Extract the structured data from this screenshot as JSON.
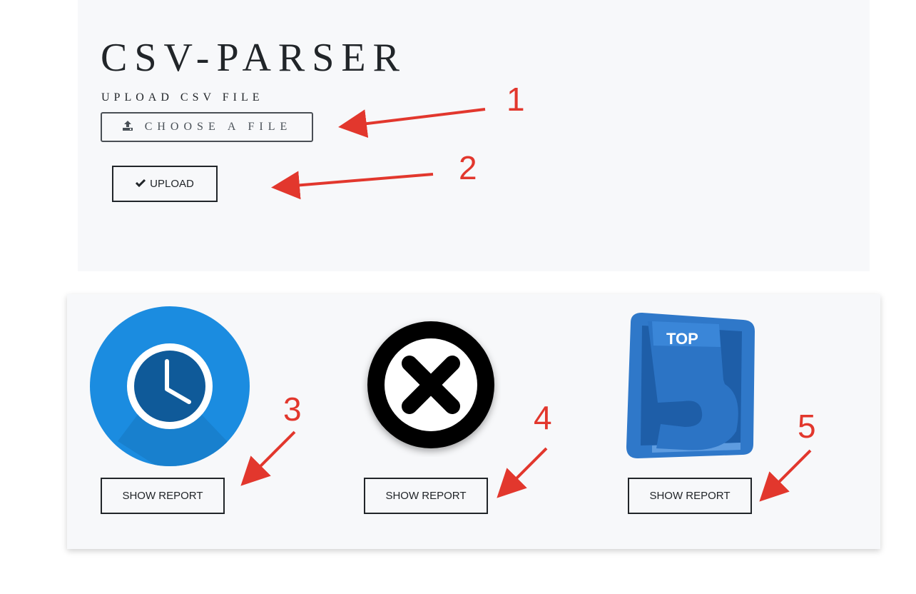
{
  "header": {
    "title": "CSV-PARSER",
    "upload_label": "UPLOAD CSV FILE",
    "choose_button_label": "CHOOSE A FILE",
    "choose_button_icon": "upload-icon",
    "upload_button_label": "UPLOAD",
    "upload_button_icon": "checkmark-icon"
  },
  "reports": [
    {
      "icon": "clock-icon",
      "button_label": "SHOW REPORT"
    },
    {
      "icon": "x-circle-icon",
      "button_label": "SHOW REPORT"
    },
    {
      "icon": "top-5-icon",
      "icon_text_top": "TOP",
      "icon_text_number": "5",
      "button_label": "SHOW REPORT"
    }
  ],
  "annotations": [
    "1",
    "2",
    "3",
    "4",
    "5"
  ],
  "colors": {
    "annotation": "#e2372d",
    "clock_blue": "#1b8ce0",
    "clock_face": "#0f5a99",
    "top5_blue": "#2f78c9",
    "panel_bg": "#f7f8fa"
  }
}
